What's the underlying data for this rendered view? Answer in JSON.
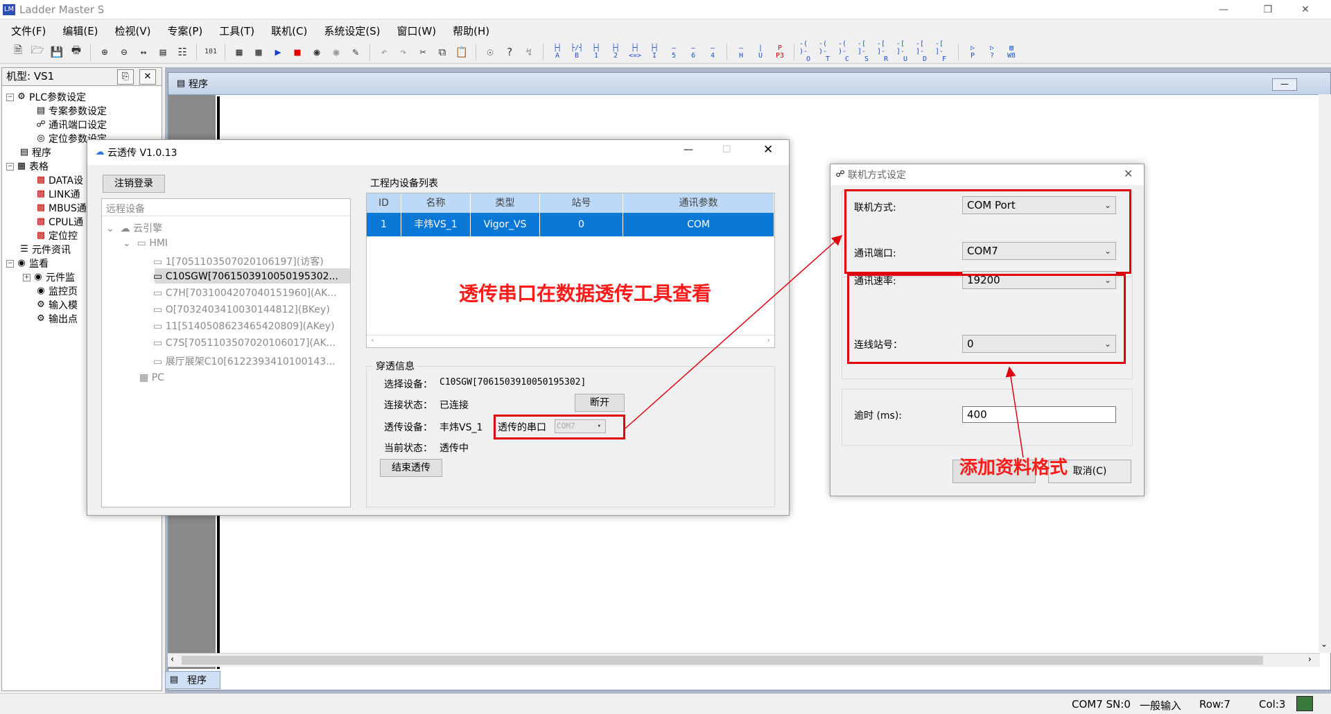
{
  "app": {
    "title": "Ladder Master S"
  },
  "menu": [
    "文件(F)",
    "编辑(E)",
    "检视(V)",
    "专案(P)",
    "工具(T)",
    "联机(C)",
    "系统设定(S)",
    "窗口(W)",
    "帮助(H)"
  ],
  "toolbar_labels": [
    "A",
    "B",
    "1",
    "2",
    "<=>",
    "I",
    "5",
    "6",
    "4",
    "H",
    "U",
    "P3",
    "O",
    "T",
    "C",
    "S",
    "R",
    "U",
    "D",
    "F",
    "P",
    "?",
    "W8"
  ],
  "left_panel": {
    "title": "机型: VS1",
    "tree": [
      "PLC参数设定",
      "专案参数设定",
      "通讯端口设定",
      "定位参数设定",
      "程序",
      "表格",
      "DATA设",
      "LINK通",
      "MBUS通",
      "CPUL通",
      "定位控",
      "元件资讯",
      "监看",
      "元件监",
      "监控页",
      "输入模",
      "输出点"
    ]
  },
  "program_window": {
    "title": "程序",
    "tab": "程序"
  },
  "statusbar": {
    "port": "COM7 SN:0",
    "mode": "一般输入",
    "row": "Row:7",
    "col": "Col:3"
  },
  "cloud_dialog": {
    "title": "云透传 V1.0.13",
    "logout": "注销登录",
    "remote_label": "远程设备",
    "tree": [
      "云引擎",
      "HMI",
      "1[7051103507020106197](访客)",
      "C10SGW[7061503910050195302...",
      "C7H[7031004207040151960](AK...",
      "O[7032403410030144812](BKey)",
      "11[5140508623465420809](AKey)",
      "C7S[7051103507020106017](AK...",
      "展厅展架C10[6122393410100143...",
      "PC"
    ],
    "project_label": "工程内设备列表",
    "table_headers": [
      "ID",
      "名称",
      "类型",
      "站号",
      "通讯参数"
    ],
    "table_row": [
      "1",
      "丰炜VS_1",
      "Vigor_VS",
      "0",
      "COM"
    ],
    "info_group": "穿透信息",
    "select_device_label": "选择设备：",
    "select_device_value": "C10SGW[7061503910050195302]",
    "conn_status_label": "连接状态：",
    "conn_status_value": "已连接",
    "disconnect": "断开",
    "trans_device_label": "透传设备：",
    "trans_device_value": "丰炜VS_1",
    "trans_port_label": "透传的串口",
    "trans_port_value": "COM7",
    "current_status_label": "当前状态：",
    "current_status_value": "透传中",
    "end_button": "结束透传"
  },
  "conn_dialog": {
    "title": "联机方式设定",
    "method_label": "联机方式:",
    "method_value": "COM Port",
    "port_label": "通讯端口:",
    "port_value": "COM7",
    "baud_label": "通讯速率:",
    "baud_value": "19200",
    "station_label": "连线站号：",
    "station_value": "0",
    "timeout_label": "逾时 (ms):",
    "timeout_value": "400",
    "cancel": "取消(C)"
  },
  "annotations": {
    "center": "透传串口在数据透传工具查看",
    "right": "添加资料格式"
  },
  "colors": {
    "annotation": "#ff1a1a",
    "selected_row": "#0a78d7",
    "table_header": "#bcdaf7"
  }
}
